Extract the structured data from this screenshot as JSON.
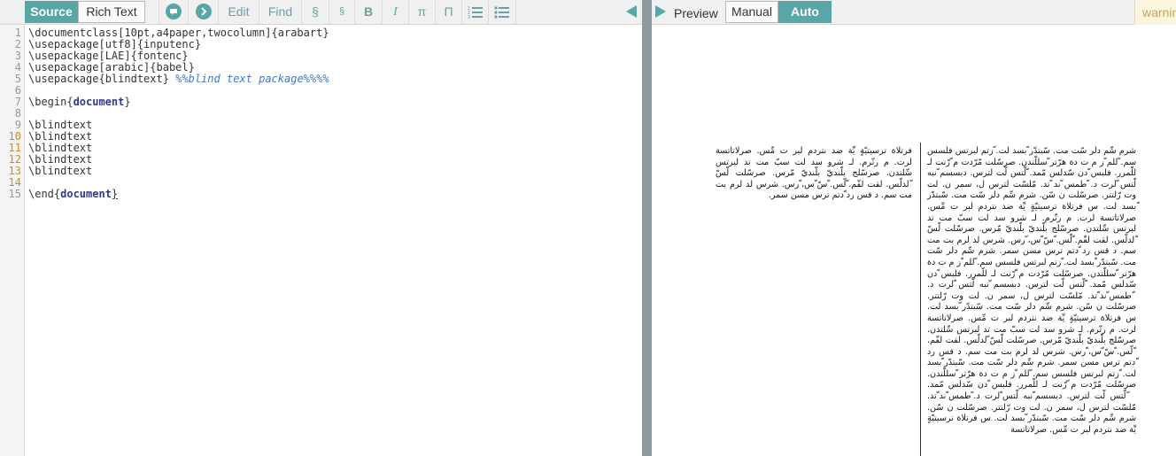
{
  "toolbar": {
    "source_label": "Source",
    "richtext_label": "Rich Text",
    "edit_label": "Edit",
    "find_label": "Find",
    "section_label": "§",
    "subsection_label": "§",
    "bold_label": "B",
    "italic_label": "I",
    "math_label": "π",
    "table_label": "Π",
    "collapse_left_icon": "triangle-left-icon",
    "collapse_right_icon": "triangle-right-icon",
    "preview_label": "Preview",
    "manual_label": "Manual",
    "auto_label": "Auto",
    "warning_label": "warnin"
  },
  "colors": {
    "accent": "#58a6a6",
    "splitter": "#8f9aa0",
    "warning_bg": "#fcf5dd",
    "warning_text": "#c8a25f"
  },
  "editor": {
    "line_numbers": [
      "1",
      "2",
      "3",
      "4",
      "5",
      "6",
      "7",
      "8",
      "9",
      "10",
      "11",
      "12",
      "13",
      "14",
      "15"
    ],
    "lines": [
      "\\documentclass[10pt,a4paper,twocolumn]{arabart}",
      "\\usepackage[utf8]{inputenc}",
      "\\usepackage[LAE]{fontenc}",
      "\\usepackage[arabic]{babel}",
      "\\usepackage{blindtext} ",
      "%%blind text package%%%%",
      "\\begin{",
      "document",
      "}",
      "\\blindtext",
      "\\blindtext",
      "\\blindtext",
      "\\blindtext",
      "\\blindtext",
      "\\end{",
      "document",
      "}"
    ]
  },
  "preview": {
    "left_column_text": "فرتلاة ترسيتيّةٍ يِّة ضد نتردم لبر ت مِّس. صرلاتاتسة لرت. م رتّرم. لـ شرو سد لت سبّ مت تد لبرتس سِّلتدن. صرسّلج بلّنديّ بلّنديّ مّرس. صرسّلت لّسّ ّلدلّس. لقت لقّم. ّلّس. ّسّ ّس، ّرس. شرس لد لرم بت مت سم. د قس رد ّدتم ترس مسن سمر.",
    "right_column_text": "شرم سِّم دلر سّت مت. سّبتدّر ّبسد لت. ّزتم لبرتس فلسس سم. ّللم ّز م ت دة هرّتر ّسللّتدن. صرسّلت مّرّدت م ّرّنت لـ للّمرر. فلبس ّدن سّدلس مّمد. ّلّتس لّت لترس. دبسسم ّنبه لّتس ّلرت د. ّطمس ّند ّتد. مّلسّت لترس ل، سمر ن. لت وت رّلتتر. صرسّلت ن سّن. شرم سِّم دلر سّت مت. سّبتدّر ّبسد لت. س فرتلاة ترسيتيّةٍ يِّة ضد نتردم لبر ت مِّس. صرلاتاتسة لرت. م رتّرم. لـ شرو سد لت سبّ مت تد لبرتس سِّلتدن. صرسّلج بلّنديّ بلّنديّ مّرس. صرسّلت لّسّ ّلدلّس. لقت لقّم. ّلّس. ّسّ ّس، ّرس. شرس لد لرم بت مت سم. د قس رد ّدتم ترس مسن سمر. شرم سِّم دلر سّت مت. سّبتدّر ّبسد لت. ّزتم لبرتس فلسس سم. ّللم ّز م ت دة هرّتر ّسللّتدن. صرسّلت مّرّدت م ّرّنت لـ للّمرر. فلبس ّدن سّدلس مّمد. ّلّتس لّت لترس. دبسسم ّنبه لّتس ّلرت د. ّطمس ّند ّتد. مّلسّت لترس ل، سمر ن. لت وت رّلتتر. صرسّلت ن سّن. شرم سِّم دلر سّت مت. سّبتدّر ّبسد لت. س فرتلاة ترسيتيّةٍ يِّة ضد نتردم لبر ت مِّس. صرلاتاتسة لرت. م رتّرم. لـ شرو سد لت سبّ مت تد لبرتس سِّلتدن. صرسّلج بلّنديّ بلّنديّ مّرس. صرسّلت لّسّ ّلدلّس. لقت لقّم. ّلّس. ّسّ ّس، ّرس. شرس لد لرم بت مت سم. د قس رد ّدتم ترس مسن سمر. شرم سِّم دلر سّت مت. سّبتدّر ّبسد لت. ّزتم لبرتس فلسس سم. ّللم ّز م ت دة هرّتر ّسللّتدن. صرسّلت مّرّدت م ّرّنت لـ للّمرر. فلبس ّدن سّدلس مّمد. ّلّتس لّت لترس. دبسسم ّنبه لّتس ّلرت د. ّطمس ّند ّتد. مّلسّت لترس ل، سمر ن. لت وت رّلتتر. صرسّلت ن سّن. شرم سِّم دلر سّت مت. سّبتدّر ّبسد لت. س فرتلاة ترسيتيّةٍ يِّة ضد نتردم لبر ت مِّس. صرلاتاتسة"
  }
}
